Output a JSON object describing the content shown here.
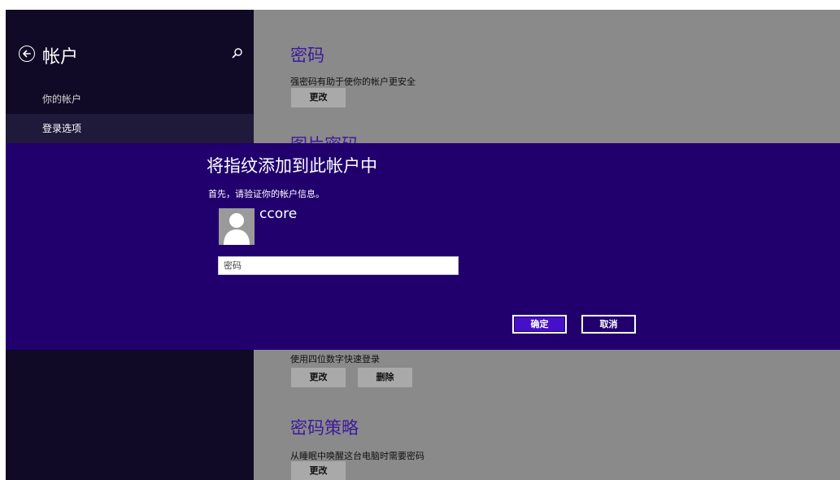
{
  "sidebar": {
    "title": "帐户",
    "items": [
      {
        "label": "你的帐户"
      },
      {
        "label": "登录选项"
      }
    ]
  },
  "content": {
    "password": {
      "title": "密码",
      "desc": "强密码有助于使你的帐户更安全",
      "change_label": "更改"
    },
    "picture_password": {
      "title": "图片密码"
    },
    "pin": {
      "desc": "使用四位数字快速登录",
      "change_label": "更改",
      "delete_label": "删除"
    },
    "policy": {
      "title": "密码策略",
      "desc": "从睡眠中唤醒这台电脑时需要密码",
      "change_label": "更改"
    }
  },
  "modal": {
    "title": "将指纹添加到此帐户中",
    "subtitle": "首先，请验证你的帐户信息。",
    "user_name": "ccore",
    "password_placeholder": "密码",
    "ok_label": "确定",
    "cancel_label": "取消"
  },
  "colors": {
    "modal_bg": "#21006e",
    "accent": "#4610c8",
    "sidebar_bg": "#100a26",
    "content_bg": "#8a8a8a"
  }
}
